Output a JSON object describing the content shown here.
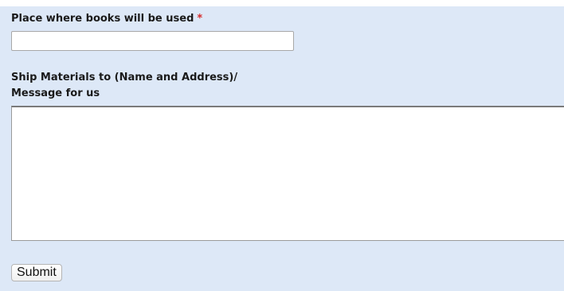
{
  "form": {
    "place_field": {
      "label": "Place where books will be used",
      "required_marker": "*",
      "value": ""
    },
    "ship_field": {
      "label_line1": "Ship Materials to (Name and Address)/",
      "label_line2": "Message for us",
      "value": ""
    },
    "submit_label": "Submit"
  },
  "colors": {
    "panel_background": "#dde8f7",
    "required_marker": "#d62b2b"
  }
}
